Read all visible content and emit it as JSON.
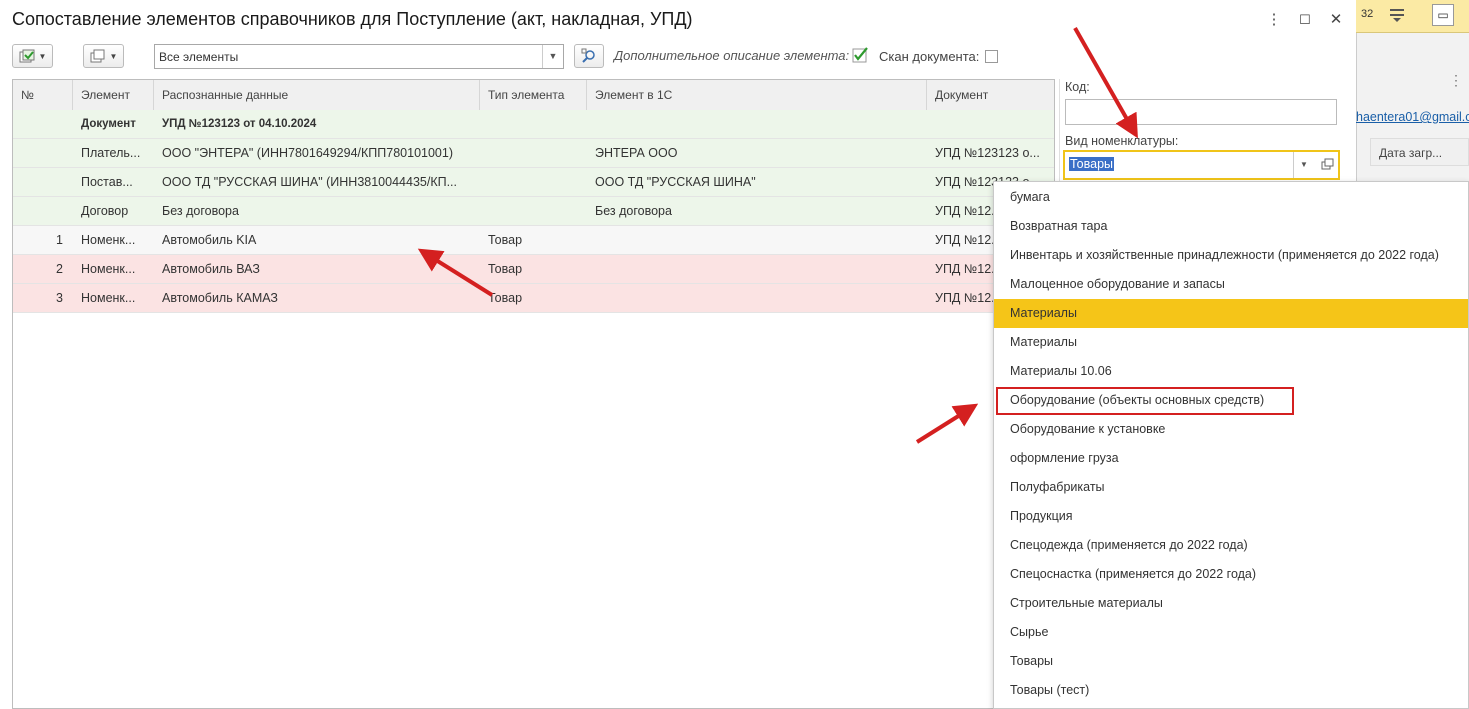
{
  "window": {
    "title": "Сопоставление элементов справочников для Поступление (акт, накладная, УПД)",
    "more_icon": "⋮",
    "maximize_icon": "☐",
    "close_icon": "✕"
  },
  "background": {
    "counter": "32",
    "email": "haentera01@gmail.c",
    "column_header": "Дата загр...",
    "more_icon": "⋮"
  },
  "toolbar": {
    "filter_value": "Все элементы",
    "extra_description_label": "Дополнительное описание элемента:",
    "extra_description_checked": true,
    "scan_label": "Скан документа:",
    "scan_checked": false
  },
  "table": {
    "columns": [
      "№",
      "Элемент",
      "Распознанные данные",
      "Тип элемента",
      "Элемент в 1С",
      "Документ"
    ],
    "rows": [
      {
        "num": "",
        "element": "Документ",
        "recognized": "УПД №123123 от 04.10.2024",
        "type": "",
        "element_1c": "",
        "document": "",
        "style": "group"
      },
      {
        "num": "",
        "element": "Платель...",
        "recognized": "ООО \"ЭНТЕРА\" (ИНН7801649294/КПП780101001)",
        "type": "",
        "element_1c": "ЭНТЕРА ООО",
        "document": "УПД №123123 о...",
        "style": "green"
      },
      {
        "num": "",
        "element": "Постав...",
        "recognized": "ООО ТД \"РУССКАЯ ШИНА\" (ИНН3810044435/КП...",
        "type": "",
        "element_1c": "ООО ТД \"РУССКАЯ ШИНА\"",
        "document": "УПД №123123 о...",
        "style": "green"
      },
      {
        "num": "",
        "element": "Договор",
        "recognized": "Без договора",
        "type": "",
        "element_1c": "Без договора",
        "document": "УПД №12...",
        "style": "green"
      },
      {
        "num": "1",
        "element": "Номенк...",
        "recognized": "Автомобиль KIA",
        "type": "Товар",
        "element_1c": "",
        "document": "УПД №12...",
        "style": "plain"
      },
      {
        "num": "2",
        "element": "Номенк...",
        "recognized": "Автомобиль ВАЗ",
        "type": "Товар",
        "element_1c": "",
        "document": "УПД №12...",
        "style": "red"
      },
      {
        "num": "3",
        "element": "Номенк...",
        "recognized": "Автомобиль КАМАЗ",
        "type": "Товар",
        "element_1c": "",
        "document": "УПД №12...",
        "style": "red"
      }
    ]
  },
  "right_panel": {
    "code_label": "Код:",
    "code_value": "",
    "kind_label": "Вид номенклатуры:",
    "kind_value": "Товары"
  },
  "dropdown": {
    "options": [
      "бумага",
      "Возвратная тара",
      "Инвентарь и хозяйственные принадлежности (применяется до 2022 года)",
      "Малоценное оборудование и запасы",
      "Материалы",
      "Материалы",
      "Материалы 10.06",
      "Оборудование (объекты основных средств)",
      "Оборудование к установке",
      "оформление груза",
      "Полуфабрикаты",
      "Продукция",
      "Спецодежда (применяется до 2022 года)",
      "Спецоснастка (применяется до 2022 года)",
      "Строительные материалы",
      "Сырье",
      "Товары",
      "Товары (тест)"
    ],
    "highlighted_index": 4,
    "boxed_index": 7
  },
  "colors": {
    "row_green": "#edf6ea",
    "row_red": "#fbe3e3",
    "row_group": "#edf6ea",
    "highlight": "#f5c518",
    "annotation": "#d42020"
  }
}
